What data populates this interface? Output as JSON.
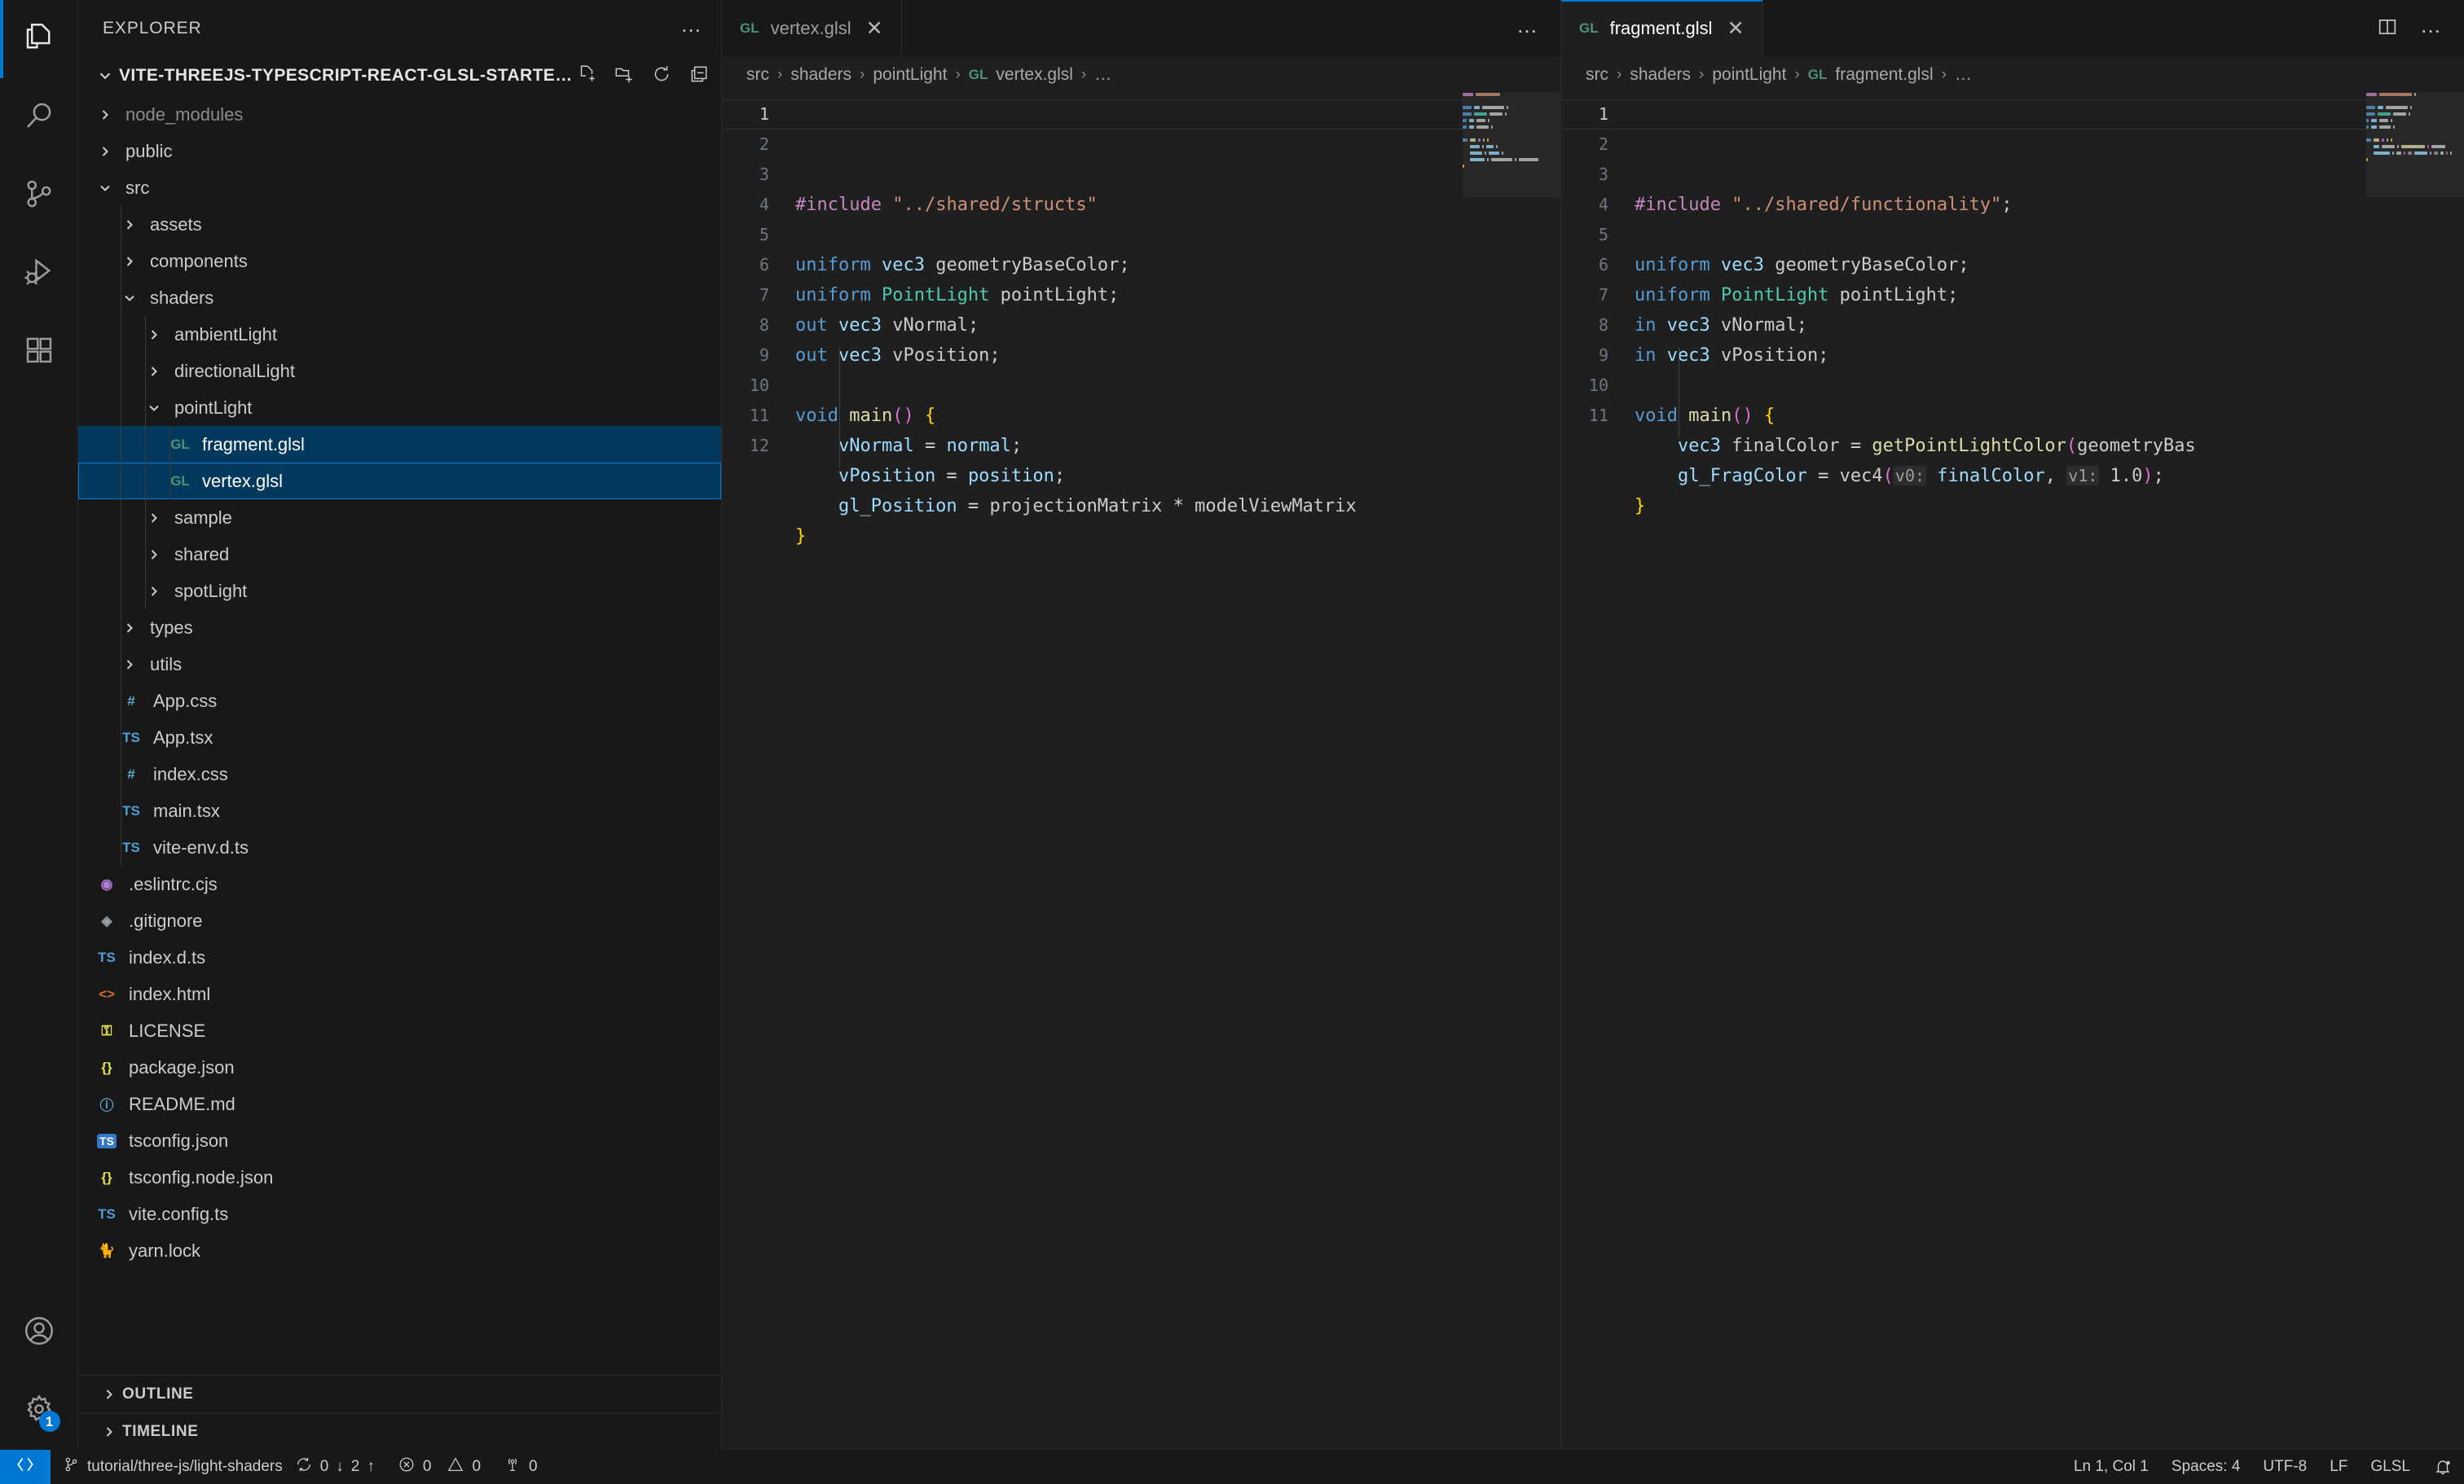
{
  "activitybar": {
    "items": [
      {
        "name": "explorer",
        "icon": "files-icon",
        "active": true
      },
      {
        "name": "search",
        "icon": "search-icon",
        "active": false
      },
      {
        "name": "source-control",
        "icon": "source-control-icon",
        "active": false
      },
      {
        "name": "run-debug",
        "icon": "run-debug-icon",
        "active": false
      },
      {
        "name": "extensions",
        "icon": "extensions-icon",
        "active": false
      }
    ],
    "bottom": [
      {
        "name": "accounts",
        "icon": "account-icon"
      },
      {
        "name": "manage",
        "icon": "gear-icon",
        "badge": "1"
      }
    ]
  },
  "sidebar": {
    "title": "EXPLORER",
    "more_actions": "…",
    "root_label": "VITE-THREEJS-TYPESCRIPT-REACT-GLSL-STARTER-…",
    "root_actions": [
      "new-file-icon",
      "new-folder-icon",
      "refresh-icon",
      "collapse-all-icon"
    ],
    "tree": [
      {
        "label": "node_modules",
        "kind": "folder",
        "depth": 1,
        "expanded": false,
        "dimmed": true
      },
      {
        "label": "public",
        "kind": "folder",
        "depth": 1,
        "expanded": false,
        "dimmed": false
      },
      {
        "label": "src",
        "kind": "folder",
        "depth": 1,
        "expanded": true,
        "dimmed": false
      },
      {
        "label": "assets",
        "kind": "folder",
        "depth": 2,
        "expanded": false,
        "dimmed": false
      },
      {
        "label": "components",
        "kind": "folder",
        "depth": 2,
        "expanded": false,
        "dimmed": false
      },
      {
        "label": "shaders",
        "kind": "folder",
        "depth": 2,
        "expanded": true,
        "dimmed": false
      },
      {
        "label": "ambientLight",
        "kind": "folder",
        "depth": 3,
        "expanded": false,
        "dimmed": false
      },
      {
        "label": "directionalLight",
        "kind": "folder",
        "depth": 3,
        "expanded": false,
        "dimmed": false
      },
      {
        "label": "pointLight",
        "kind": "folder",
        "depth": 3,
        "expanded": true,
        "dimmed": false
      },
      {
        "label": "fragment.glsl",
        "kind": "file",
        "icon": "GL",
        "icon_color": "#4d9375",
        "depth": 4,
        "selected": true
      },
      {
        "label": "vertex.glsl",
        "kind": "file",
        "icon": "GL",
        "icon_color": "#4d9375",
        "depth": 4,
        "selected": true,
        "focused": true
      },
      {
        "label": "sample",
        "kind": "folder",
        "depth": 3,
        "expanded": false,
        "dimmed": false
      },
      {
        "label": "shared",
        "kind": "folder",
        "depth": 3,
        "expanded": false,
        "dimmed": false
      },
      {
        "label": "spotLight",
        "kind": "folder",
        "depth": 3,
        "expanded": false,
        "dimmed": false
      },
      {
        "label": "types",
        "kind": "folder",
        "depth": 2,
        "expanded": false,
        "dimmed": false
      },
      {
        "label": "utils",
        "kind": "folder",
        "depth": 2,
        "expanded": false,
        "dimmed": false
      },
      {
        "label": "App.css",
        "kind": "file",
        "icon": "#",
        "icon_color": "#5ba8d4",
        "depth": 2
      },
      {
        "label": "App.tsx",
        "kind": "file",
        "icon": "TS",
        "icon_color": "#4d9fd6",
        "depth": 2
      },
      {
        "label": "index.css",
        "kind": "file",
        "icon": "#",
        "icon_color": "#5ba8d4",
        "depth": 2
      },
      {
        "label": "main.tsx",
        "kind": "file",
        "icon": "TS",
        "icon_color": "#4d9fd6",
        "depth": 2
      },
      {
        "label": "vite-env.d.ts",
        "kind": "file",
        "icon": "TS",
        "icon_color": "#4d9fd6",
        "depth": 2
      },
      {
        "label": ".eslintrc.cjs",
        "kind": "file",
        "icon": "◉",
        "icon_color": "#b07cd8",
        "depth": 1
      },
      {
        "label": ".gitignore",
        "kind": "file",
        "icon": "◈",
        "icon_color": "#9aa0a6",
        "depth": 1
      },
      {
        "label": "index.d.ts",
        "kind": "file",
        "icon": "TS",
        "icon_color": "#4d9fd6",
        "depth": 1
      },
      {
        "label": "index.html",
        "kind": "file",
        "icon": "<>",
        "icon_color": "#d4692a",
        "depth": 1
      },
      {
        "label": "LICENSE",
        "kind": "file",
        "icon": "⚿",
        "icon_color": "#e3e34a",
        "depth": 1
      },
      {
        "label": "package.json",
        "kind": "file",
        "icon": "{}",
        "icon_color": "#e3e34a",
        "depth": 1
      },
      {
        "label": "README.md",
        "kind": "file",
        "icon": "ⓘ",
        "icon_color": "#5ba8d4",
        "depth": 1
      },
      {
        "label": "tsconfig.json",
        "kind": "file",
        "icon": "TS",
        "icon_color": "#3178c6",
        "depth": 1,
        "boxed": true
      },
      {
        "label": "tsconfig.node.json",
        "kind": "file",
        "icon": "{}",
        "icon_color": "#e3e34a",
        "depth": 1
      },
      {
        "label": "vite.config.ts",
        "kind": "file",
        "icon": "TS",
        "icon_color": "#4d9fd6",
        "depth": 1
      },
      {
        "label": "yarn.lock",
        "kind": "file",
        "icon": "🐈",
        "icon_color": "#6ab0de",
        "depth": 1
      }
    ],
    "sections": [
      {
        "label": "OUTLINE",
        "expanded": false
      },
      {
        "label": "TIMELINE",
        "expanded": false
      }
    ]
  },
  "editor_left": {
    "tab": {
      "icon": "GL",
      "label": "vertex.glsl",
      "close": "✕",
      "active": false
    },
    "breadcrumbs": [
      "src",
      "shaders",
      "pointLight",
      "vertex.glsl",
      "…"
    ],
    "breadcrumb_file_icon": "GL",
    "lines": [
      {
        "n": "1",
        "tokens": [
          {
            "t": "#include ",
            "c": "t-pp"
          },
          {
            "t": "\"../shared/structs\"",
            "c": "t-str"
          }
        ]
      },
      {
        "n": "2",
        "tokens": []
      },
      {
        "n": "3",
        "tokens": [
          {
            "t": "uniform ",
            "c": "t-kw"
          },
          {
            "t": "vec3",
            "c": "t-var"
          },
          {
            "t": " geometryBaseColor",
            "c": "t-pun"
          },
          {
            "t": ";",
            "c": "t-pun"
          }
        ]
      },
      {
        "n": "4",
        "tokens": [
          {
            "t": "uniform ",
            "c": "t-kw"
          },
          {
            "t": "PointLight",
            "c": "t-type"
          },
          {
            "t": " pointLight",
            "c": "t-pun"
          },
          {
            "t": ";",
            "c": "t-pun"
          }
        ]
      },
      {
        "n": "5",
        "tokens": [
          {
            "t": "out ",
            "c": "t-kw"
          },
          {
            "t": "vec3",
            "c": "t-var"
          },
          {
            "t": " vNormal",
            "c": "t-pun"
          },
          {
            "t": ";",
            "c": "t-pun"
          }
        ]
      },
      {
        "n": "6",
        "tokens": [
          {
            "t": "out ",
            "c": "t-kw"
          },
          {
            "t": "vec3",
            "c": "t-var"
          },
          {
            "t": " vPosition",
            "c": "t-pun"
          },
          {
            "t": ";",
            "c": "t-pun"
          }
        ]
      },
      {
        "n": "7",
        "tokens": []
      },
      {
        "n": "8",
        "tokens": [
          {
            "t": "void ",
            "c": "t-kw"
          },
          {
            "t": "main",
            "c": "t-fn"
          },
          {
            "t": "()",
            "c": "t-paren"
          },
          {
            "t": " ",
            "c": "t-pun"
          },
          {
            "t": "{",
            "c": "t-brace"
          }
        ]
      },
      {
        "n": "9",
        "tokens": [
          {
            "t": "    vNormal",
            "c": "t-var"
          },
          {
            "t": " = ",
            "c": "t-op"
          },
          {
            "t": "normal",
            "c": "t-var"
          },
          {
            "t": ";",
            "c": "t-pun"
          }
        ]
      },
      {
        "n": "10",
        "tokens": [
          {
            "t": "    vPosition",
            "c": "t-var"
          },
          {
            "t": " = ",
            "c": "t-op"
          },
          {
            "t": "position",
            "c": "t-var"
          },
          {
            "t": ";",
            "c": "t-pun"
          }
        ]
      },
      {
        "n": "11",
        "tokens": [
          {
            "t": "    gl_Position",
            "c": "t-var"
          },
          {
            "t": " = ",
            "c": "t-op"
          },
          {
            "t": "projectionMatrix",
            "c": "t-pun"
          },
          {
            "t": " * ",
            "c": "t-op"
          },
          {
            "t": "modelViewMatrix",
            "c": "t-pun"
          }
        ]
      },
      {
        "n": "12",
        "tokens": [
          {
            "t": "}",
            "c": "t-brace"
          }
        ]
      }
    ]
  },
  "editor_right": {
    "tab": {
      "icon": "GL",
      "label": "fragment.glsl",
      "close": "✕",
      "active": true
    },
    "breadcrumbs": [
      "src",
      "shaders",
      "pointLight",
      "fragment.glsl",
      "…"
    ],
    "breadcrumb_file_icon": "GL",
    "actions": [
      "split-editor-icon",
      "more-actions-icon"
    ],
    "lines": [
      {
        "n": "1",
        "tokens": [
          {
            "t": "#include ",
            "c": "t-pp"
          },
          {
            "t": "\"../shared/functionality\"",
            "c": "t-str"
          },
          {
            "t": ";",
            "c": "t-pun"
          }
        ]
      },
      {
        "n": "2",
        "tokens": []
      },
      {
        "n": "3",
        "tokens": [
          {
            "t": "uniform ",
            "c": "t-kw"
          },
          {
            "t": "vec3",
            "c": "t-var"
          },
          {
            "t": " geometryBaseColor",
            "c": "t-pun"
          },
          {
            "t": ";",
            "c": "t-pun"
          }
        ]
      },
      {
        "n": "4",
        "tokens": [
          {
            "t": "uniform ",
            "c": "t-kw"
          },
          {
            "t": "PointLight",
            "c": "t-type"
          },
          {
            "t": " pointLight",
            "c": "t-pun"
          },
          {
            "t": ";",
            "c": "t-pun"
          }
        ]
      },
      {
        "n": "5",
        "tokens": [
          {
            "t": "in ",
            "c": "t-kw"
          },
          {
            "t": "vec3",
            "c": "t-var"
          },
          {
            "t": " vNormal",
            "c": "t-pun"
          },
          {
            "t": ";",
            "c": "t-pun"
          }
        ]
      },
      {
        "n": "6",
        "tokens": [
          {
            "t": "in ",
            "c": "t-kw"
          },
          {
            "t": "vec3",
            "c": "t-var"
          },
          {
            "t": " vPosition",
            "c": "t-pun"
          },
          {
            "t": ";",
            "c": "t-pun"
          }
        ]
      },
      {
        "n": "7",
        "tokens": []
      },
      {
        "n": "8",
        "tokens": [
          {
            "t": "void ",
            "c": "t-kw"
          },
          {
            "t": "main",
            "c": "t-fn"
          },
          {
            "t": "()",
            "c": "t-paren"
          },
          {
            "t": " ",
            "c": "t-pun"
          },
          {
            "t": "{",
            "c": "t-brace"
          }
        ]
      },
      {
        "n": "9",
        "tokens": [
          {
            "t": "    vec3",
            "c": "t-var"
          },
          {
            "t": " finalColor",
            "c": "t-pun"
          },
          {
            "t": " = ",
            "c": "t-op"
          },
          {
            "t": "getPointLightColor",
            "c": "t-fn"
          },
          {
            "t": "(",
            "c": "t-paren"
          },
          {
            "t": "geometryBas",
            "c": "t-pun"
          }
        ]
      },
      {
        "n": "10",
        "tokens": [
          {
            "t": "    gl_FragColor",
            "c": "t-var"
          },
          {
            "t": " = ",
            "c": "t-op"
          },
          {
            "t": "vec4",
            "c": "t-pun"
          },
          {
            "t": "(",
            "c": "t-paren"
          },
          {
            "t": "v0:",
            "c": "t-hint"
          },
          {
            "t": " finalColor",
            "c": "t-var"
          },
          {
            "t": ", ",
            "c": "t-pun"
          },
          {
            "t": "v1:",
            "c": "t-hint"
          },
          {
            "t": " 1.0",
            "c": "t-pun"
          },
          {
            "t": ")",
            "c": "t-paren"
          },
          {
            "t": ";",
            "c": "t-pun"
          }
        ]
      },
      {
        "n": "11",
        "tokens": [
          {
            "t": "}",
            "c": "t-brace"
          }
        ]
      }
    ]
  },
  "statusbar": {
    "remote_icon": "remote-window-icon",
    "branch_icon": "source-control-branch-icon",
    "branch": "tutorial/three-js/light-shaders",
    "sync_icon": "sync-icon",
    "sync_down": "0",
    "sync_down_arrow": "↓",
    "sync_up": "2",
    "sync_up_arrow": "↑",
    "errors_icon": "error-icon",
    "errors": "0",
    "warnings_icon": "warning-icon",
    "warnings": "0",
    "ports_icon": "radio-tower-icon",
    "ports": "0",
    "cursor_position": "Ln 1, Col 1",
    "indentation": "Spaces: 4",
    "encoding": "UTF-8",
    "eol": "LF",
    "language": "GLSL",
    "bell_icon": "bell-dot-icon"
  }
}
